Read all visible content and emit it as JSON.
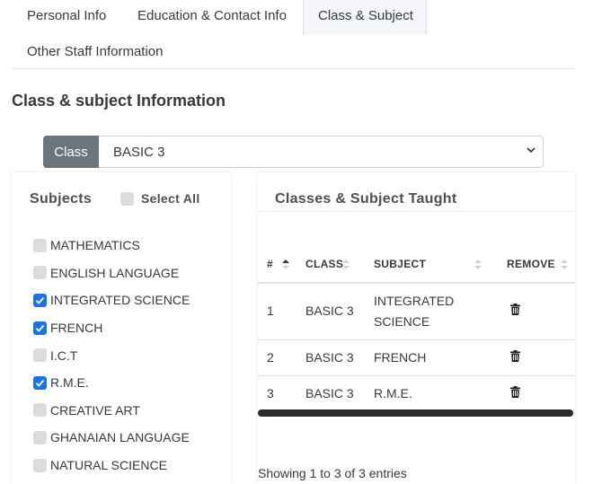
{
  "tabs": [
    "Personal Info",
    "Education & Contact Info",
    "Class & Subject",
    "Other Staff Information"
  ],
  "section_title": "Class & subject Information",
  "class_selector": {
    "label": "Class",
    "value": "BASIC 3"
  },
  "subjects": {
    "title": "Subjects",
    "select_all": "Select All",
    "items": [
      {
        "name": "MATHEMATICS",
        "checked": false
      },
      {
        "name": "ENGLISH LANGUAGE",
        "checked": false
      },
      {
        "name": "INTEGRATED SCIENCE",
        "checked": true
      },
      {
        "name": "FRENCH",
        "checked": true
      },
      {
        "name": "I.C.T",
        "checked": false
      },
      {
        "name": "R.M.E.",
        "checked": true
      },
      {
        "name": "CREATIVE ART",
        "checked": false
      },
      {
        "name": "GHANAIAN LANGUAGE",
        "checked": false
      },
      {
        "name": "NATURAL SCIENCE",
        "checked": false
      }
    ]
  },
  "taught": {
    "title": "Classes & Subject Taught",
    "columns": [
      "#",
      "CLASS",
      "SUBJECT",
      "REMOVE"
    ],
    "rows": [
      {
        "num": "1",
        "class": "BASIC 3",
        "subject": "INTEGRATED SCIENCE"
      },
      {
        "num": "2",
        "class": "BASIC 3",
        "subject": "FRENCH"
      },
      {
        "num": "3",
        "class": "BASIC 3",
        "subject": "R.M.E."
      }
    ],
    "showing": "Showing 1 to 3 of 3 entries"
  },
  "icons": {
    "remove": "trash-icon",
    "sort": "sort-arrows-icon",
    "dropdown": "chevron-down-icon",
    "check": "check-icon"
  },
  "colors": {
    "checked": "#1a73e8",
    "class_label_bg": "#6c757d"
  }
}
